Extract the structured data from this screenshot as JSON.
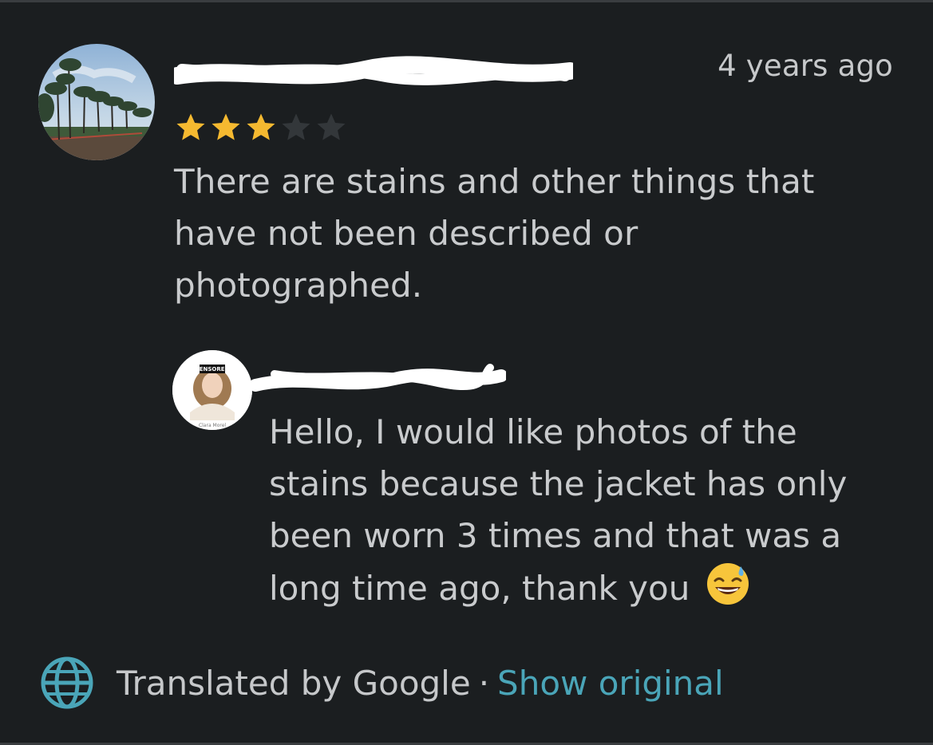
{
  "review": {
    "timestamp": "4 years ago",
    "rating": 3,
    "rating_max": 5,
    "text": "There are stains and other things that have not been described or photographed."
  },
  "reply": {
    "avatar_badge": "CENSORED",
    "avatar_caption": "Clara Morel",
    "text": "Hello, I would like photos of the stains because the jacket has only been worn 3 times and that was a long time ago, thank you"
  },
  "footer": {
    "translated_label": "Translated by Google",
    "separator": "·",
    "show_original_label": "Show original"
  },
  "colors": {
    "background": "#1b1e20",
    "star_filled": "#f5b930",
    "star_empty": "#33373a",
    "link": "#4aa5b8",
    "text": "#c9cbcd"
  },
  "icons": {
    "globe": "globe-icon",
    "star": "star-icon",
    "emoji": "grinning-sweat-emoji"
  }
}
